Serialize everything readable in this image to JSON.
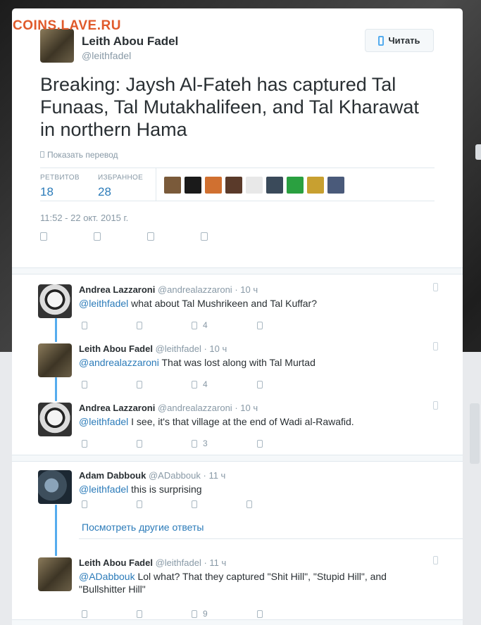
{
  "watermark": "COINS.LAVE.RU",
  "main_tweet": {
    "author_name": "Leith Abou Fadel",
    "author_handle": "@leithfadel",
    "follow_label": "Читать",
    "text": "Breaking: Jaysh Al-Fateh has captured Tal Funaas, Tal Mutakhalifeen, and Tal Kharawat in northern Hama",
    "translate_label": "Показать перевод",
    "retweets_label": "РЕТВИТОВ",
    "retweets_count": "18",
    "favorites_label": "ИЗБРАННОЕ",
    "favorites_count": "28",
    "timestamp": "11:52 - 22 окт. 2015 г.",
    "favoriter_colors": [
      "#7a5a3a",
      "#1a1a1a",
      "#d07030",
      "#5a3a2a",
      "#e8e8e8",
      "#3a4a5a",
      "#2aa040",
      "#c8a030",
      "#4a5a7a"
    ]
  },
  "replies": [
    {
      "name": "Andrea Lazzaroni",
      "handle": "@andrealazzaroni",
      "time": "· 10 ч",
      "mention": "@leithfadel",
      "text": " what about Tal Mushrikeen and Tal Kuffar?",
      "fav_count": "4"
    },
    {
      "name": "Leith Abou Fadel",
      "handle": "@leithfadel",
      "time": "· 10 ч",
      "mention": "@andrealazzaroni",
      "text": " That was lost along with Tal Murtad",
      "fav_count": "4"
    },
    {
      "name": "Andrea Lazzaroni",
      "handle": "@andrealazzaroni",
      "time": "· 10 ч",
      "mention": "@leithfadel",
      "text": " I see, it's that village at the end of Wadi al-Rawafid.",
      "fav_count": "3"
    },
    {
      "name": "Adam Dabbouk",
      "handle": "@ADabbouk",
      "time": "· 11 ч",
      "mention": "@leithfadel",
      "text": " this is surprising",
      "fav_count": ""
    },
    {
      "name": "Leith Abou Fadel",
      "handle": "@leithfadel",
      "time": "· 11 ч",
      "mention": "@ADabbouk",
      "text": " Lol what? That they captured \"Shit Hill\", \"Stupid Hill\", and \"Bullshitter Hill\"",
      "fav_count": "9"
    }
  ],
  "more_replies_label": "Посмотреть другие ответы",
  "colors": {
    "link": "#2b7bb9",
    "accent": "#55acee",
    "muted": "#8899a6",
    "text": "#292f33"
  }
}
